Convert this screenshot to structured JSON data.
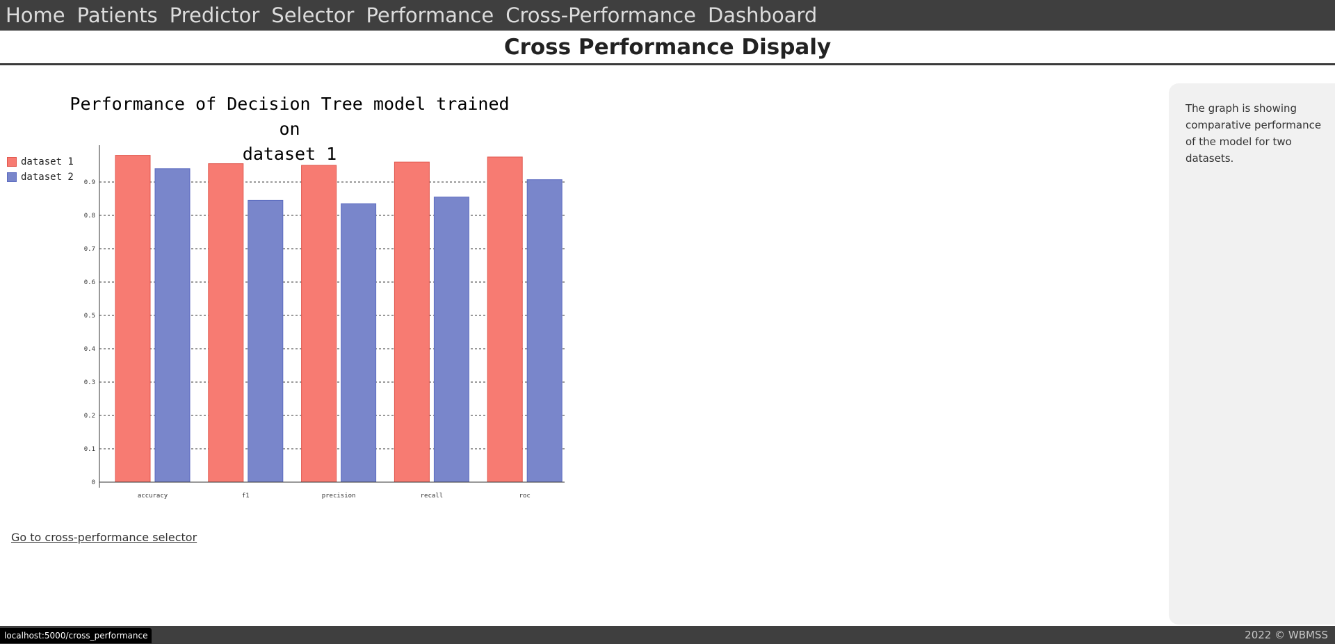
{
  "nav": {
    "items": [
      "Home",
      "Patients",
      "Predictor",
      "Selector",
      "Performance",
      "Cross-Performance",
      "Dashboard"
    ]
  },
  "page": {
    "title": "Cross Performance Dispaly"
  },
  "chart_data": {
    "type": "bar",
    "title_line1": "Performance of Decision Tree model trained on",
    "title_line2": "dataset 1",
    "categories": [
      "accuracy",
      "f1",
      "precision",
      "recall",
      "roc"
    ],
    "series": [
      {
        "name": "dataset 1",
        "color": "#f77b72",
        "stroke": "#e0564c",
        "values": [
          0.98,
          0.955,
          0.95,
          0.96,
          0.975
        ]
      },
      {
        "name": "dataset 2",
        "color": "#7986cb",
        "stroke": "#5c6bc0",
        "values": [
          0.94,
          0.845,
          0.835,
          0.855,
          0.907
        ]
      }
    ],
    "ylim": [
      0,
      1.0
    ],
    "yticks": [
      "0",
      "0.1",
      "0.2",
      "0.3",
      "0.4",
      "0.5",
      "0.6",
      "0.7",
      "0.8",
      "0.9"
    ],
    "legend_position": "top-left",
    "grid": true
  },
  "links": {
    "back": "Go to cross-performance selector"
  },
  "side_panel": {
    "text": "The graph is showing comparative performance of the model for two datasets."
  },
  "status_bar": {
    "url": "localhost:5000/cross_performance"
  },
  "footer": {
    "copyright": "2022 © WBMSS"
  }
}
